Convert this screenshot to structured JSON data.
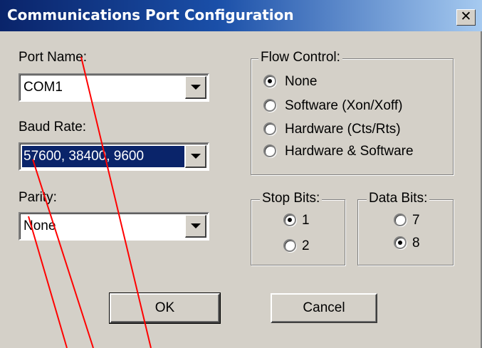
{
  "window": {
    "title": "Communications Port Configuration",
    "close_glyph": "✕"
  },
  "port_name": {
    "label": "Port Name:",
    "value": "COM1"
  },
  "baud_rate": {
    "label": "Baud Rate:",
    "value": "57600, 38400, 9600"
  },
  "parity": {
    "label": "Parity:",
    "value": "None"
  },
  "flow_control": {
    "legend": "Flow Control:",
    "options": [
      {
        "label": "None",
        "checked": true
      },
      {
        "label": "Software (Xon/Xoff)",
        "checked": false
      },
      {
        "label": "Hardware (Cts/Rts)",
        "checked": false
      },
      {
        "label": "Hardware & Software",
        "checked": false
      }
    ]
  },
  "stop_bits": {
    "legend": "Stop Bits:",
    "options": [
      {
        "label": "1",
        "checked": true
      },
      {
        "label": "2",
        "checked": false
      }
    ]
  },
  "data_bits": {
    "legend": "Data Bits:",
    "options": [
      {
        "label": "7",
        "checked": false
      },
      {
        "label": "8",
        "checked": true
      }
    ]
  },
  "buttons": {
    "ok": "OK",
    "cancel": "Cancel"
  },
  "colors": {
    "title_bar": "#0a246a",
    "dialog_bg": "#d4d0c8",
    "annotation_line": "#ff0000"
  }
}
